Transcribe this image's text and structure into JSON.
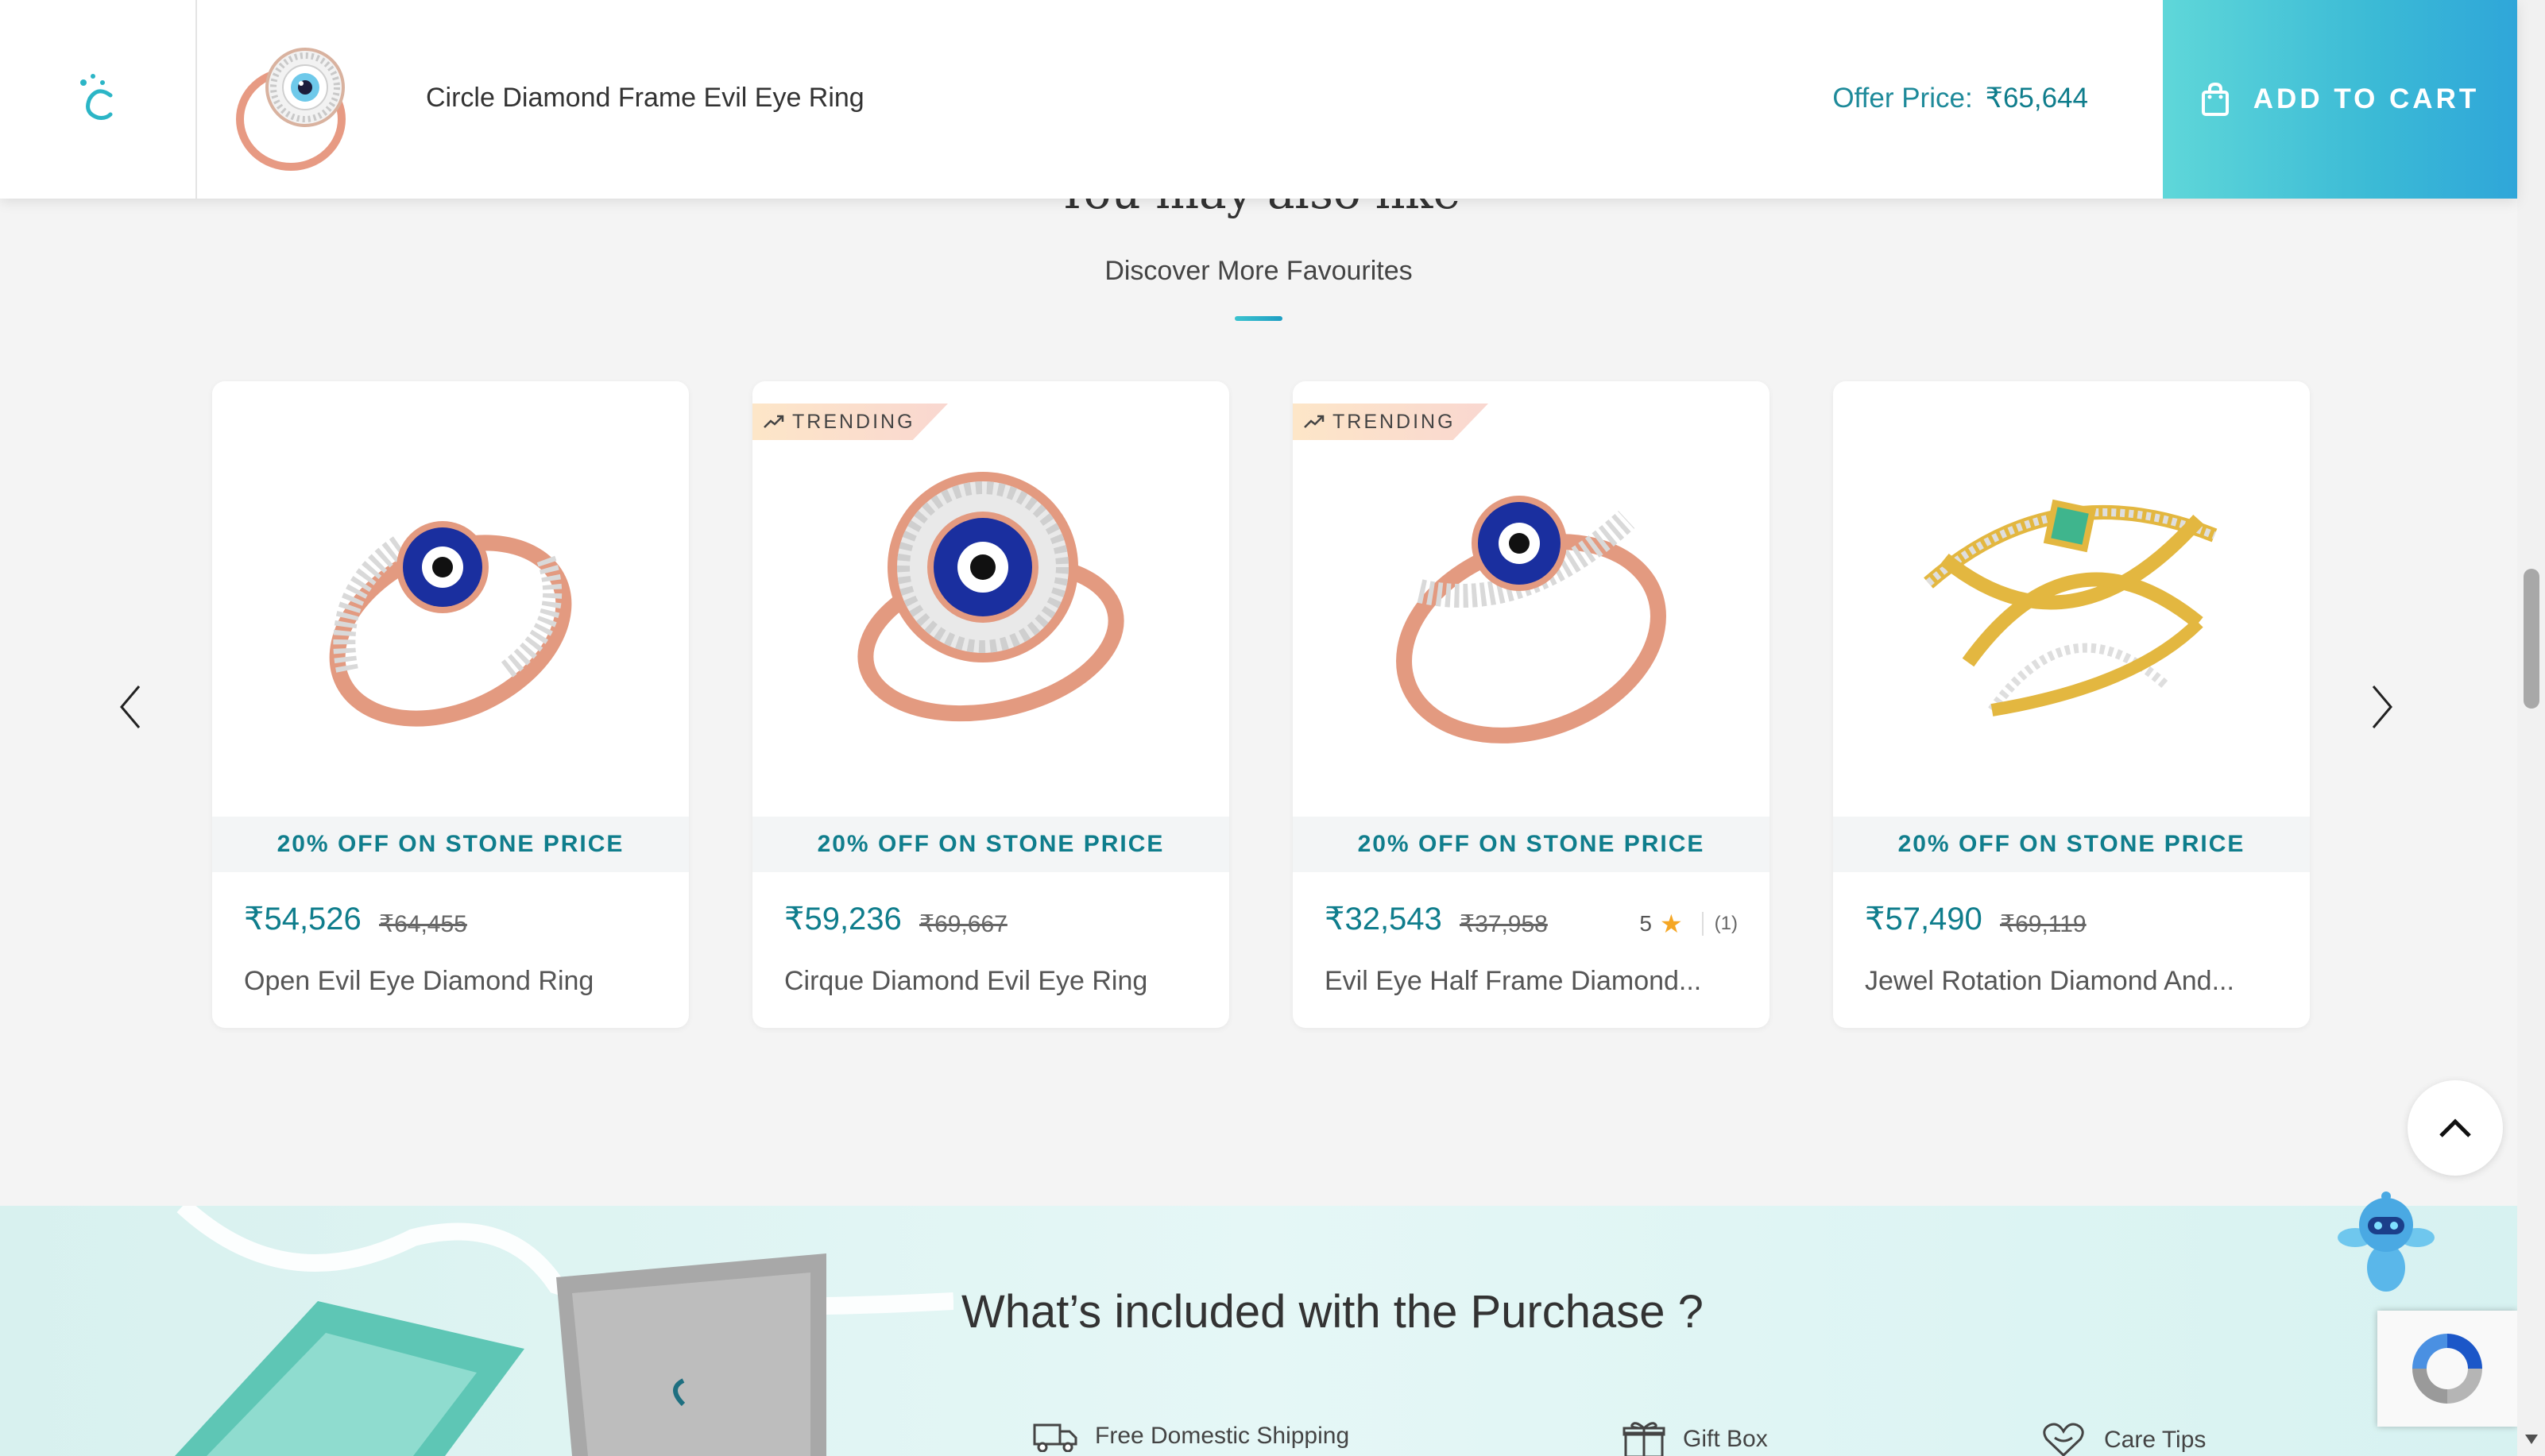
{
  "header": {
    "product_title": "Circle Diamond Frame Evil Eye Ring",
    "offer_label": "Offer Price:",
    "offer_price": "₹65,644",
    "add_to_cart": "ADD TO CART"
  },
  "section": {
    "title": "You may also like",
    "subtitle": "Discover More Favourites"
  },
  "products": [
    {
      "promo": "20% OFF ON STONE PRICE",
      "price": "₹54,526",
      "mrp": "₹64,455",
      "name": "Open Evil Eye Diamond Ring",
      "badge": ""
    },
    {
      "promo": "20% OFF ON STONE PRICE",
      "price": "₹59,236",
      "mrp": "₹69,667",
      "name": "Cirque Diamond Evil Eye Ring",
      "badge": "TRENDING"
    },
    {
      "promo": "20% OFF ON STONE PRICE",
      "price": "₹32,543",
      "mrp": "₹37,958",
      "name": "Evil Eye Half Frame Diamond...",
      "badge": "TRENDING",
      "rating": "5",
      "rating_count": "(1)"
    },
    {
      "promo": "20% OFF ON STONE PRICE",
      "price": "₹57,490",
      "mrp": "₹69,119",
      "name": "Jewel Rotation Diamond And...",
      "badge": ""
    }
  ],
  "purchase": {
    "title": "What’s included with the Purchase ?",
    "items": [
      "Free Domestic Shipping",
      "Gift Box",
      "Care Tips"
    ]
  },
  "colors": {
    "accent": "#0f7d8c",
    "cart_gradient_start": "#5fd7d9",
    "cart_gradient_end": "#2fa6d9",
    "badge": "#fde6c8",
    "star": "#f5a623"
  },
  "icons": [
    "brand-logo-icon",
    "shopping-bag-icon",
    "chevron-left-icon",
    "chevron-right-icon",
    "trending-icon",
    "star-icon",
    "chevron-up-icon",
    "truck-icon",
    "gift-icon",
    "care-icon",
    "recaptcha-icon",
    "mascot-icon"
  ]
}
